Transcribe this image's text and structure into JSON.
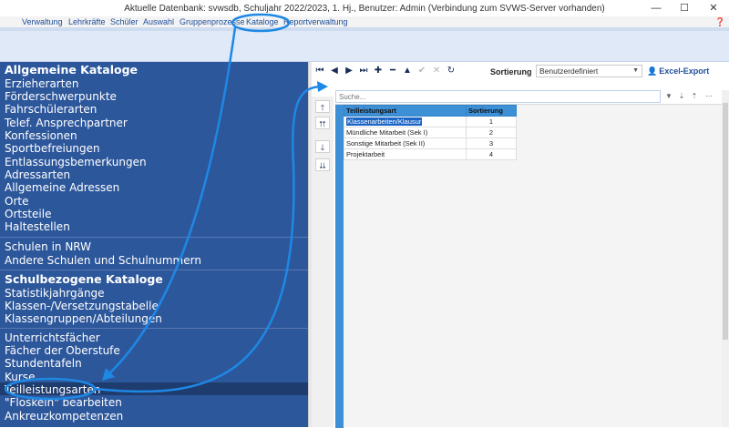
{
  "window": {
    "title": "Aktuelle Datenbank: svwsdb, Schuljahr 2022/2023, 1. Hj., Benutzer: Admin (Verbindung zum SVWS-Server vorhanden)",
    "minimize": "—",
    "maximize": "☐",
    "close": "✕"
  },
  "menu": {
    "items": [
      "Verwaltung",
      "Lehrkräfte",
      "Schüler",
      "Auswahl",
      "Gruppenprozesse",
      "Kataloge",
      "Reportverwaltung"
    ],
    "help": "❓"
  },
  "left": {
    "sections": [
      {
        "head": "Allgemeine Kataloge",
        "items": [
          "Erzieherarten",
          "Förderschwerpunkte",
          "Fahrschülerarten",
          "Telef. Ansprechpartner",
          "Konfessionen",
          "Sportbefreiungen",
          "Entlassungsbemerkungen",
          "Adressarten",
          "Allgemeine Adressen",
          "Orte",
          "Ortsteile",
          "Haltestellen"
        ]
      },
      {
        "head": "",
        "items": [
          "Schulen in NRW",
          "Andere Schulen und Schulnummern"
        ]
      },
      {
        "head": "Schulbezogene Kataloge",
        "items": [
          "Statistikjahrgänge",
          "Klassen-/Versetzungstabelle",
          "Klassengruppen/Abteilungen"
        ]
      },
      {
        "head": "",
        "items": [
          "Unterrichtsfächer",
          "Fächer der Oberstufe",
          "Stundentafeln",
          "Kurse",
          "Teilleistungsarten",
          "\"Floskeln\" bearbeiten",
          "Ankreuzkompetenzen"
        ]
      }
    ],
    "selected": "Teilleistungsarten"
  },
  "toolbar": {
    "buttons": [
      {
        "name": "first-record-button",
        "icon": "⏮"
      },
      {
        "name": "prev-record-button",
        "icon": "◀"
      },
      {
        "name": "next-record-button",
        "icon": "▶"
      },
      {
        "name": "last-record-button",
        "icon": "⏭"
      },
      {
        "name": "add-record-button",
        "icon": "✚"
      },
      {
        "name": "delete-record-button",
        "icon": "━"
      },
      {
        "name": "edit-record-button",
        "icon": "▲"
      },
      {
        "name": "save-record-button",
        "icon": "✔"
      },
      {
        "name": "cancel-edit-button",
        "icon": "✕"
      },
      {
        "name": "refresh-button",
        "icon": "↻"
      }
    ],
    "sort_label": "Sortierung",
    "sort_value": "Benutzerdefiniert",
    "excel_label": "Excel-Export"
  },
  "side_buttons": [
    {
      "name": "move-up-button",
      "icon": "🡑"
    },
    {
      "name": "move-top-button",
      "icon": "⮅"
    },
    {
      "name": "move-down-button",
      "icon": "🡓"
    },
    {
      "name": "move-bottom-button",
      "icon": "⮇"
    }
  ],
  "search": {
    "placeholder": "Suche..."
  },
  "table": {
    "columns": [
      "Teilleistungsart",
      "Sortierung"
    ],
    "rows": [
      {
        "name": "Klassenarbeiten/Klausur",
        "sort": "1"
      },
      {
        "name": "Mündliche Mitarbeit (Sek I)",
        "sort": "2"
      },
      {
        "name": "Sonstige Mitarbeit (Sek II)",
        "sort": "3"
      },
      {
        "name": "Projektarbeit",
        "sort": "4"
      }
    ]
  },
  "colors": {
    "panel": "#2d579b",
    "accent": "#3d8fd6",
    "annotation": "#1e88e5"
  }
}
